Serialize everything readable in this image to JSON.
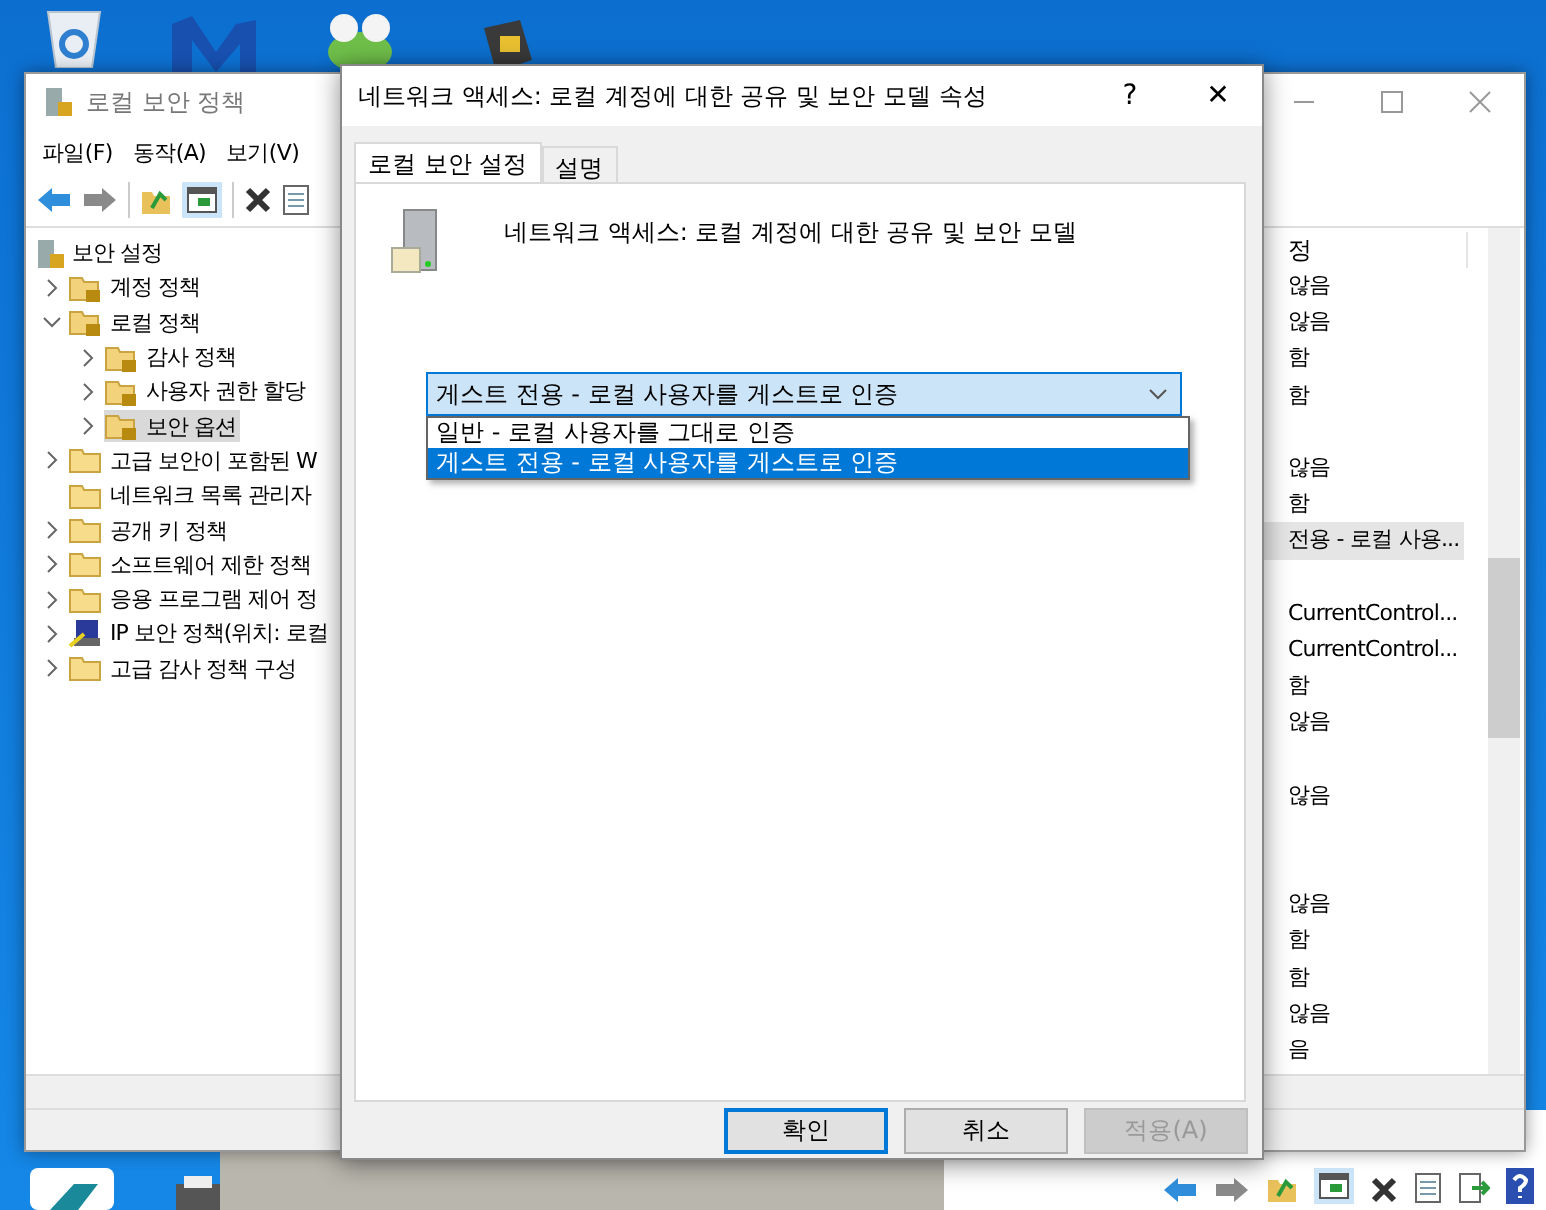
{
  "main_window": {
    "title": "로컬 보안 정책",
    "menu": [
      "파일(F)",
      "동작(A)",
      "보기(V)"
    ],
    "tree": [
      {
        "label": "보안 설정",
        "kind": "root",
        "selected": false,
        "children": [
          {
            "label": "계정 정책",
            "kind": "locked",
            "selected": false,
            "expanded": false
          },
          {
            "label": "로컬 정책",
            "kind": "locked",
            "selected": false,
            "expanded": true,
            "children": [
              {
                "label": "감사 정책",
                "kind": "locked",
                "selected": false,
                "expanded": false
              },
              {
                "label": "사용자 권한 할당",
                "kind": "locked",
                "selected": false,
                "expanded": false
              },
              {
                "label": "보안 옵션",
                "kind": "locked",
                "selected": true,
                "expanded": false
              }
            ]
          },
          {
            "label": "고급 보안이 포함된 W",
            "kind": "plain",
            "selected": false,
            "expanded": false
          },
          {
            "label": "네트워크 목록 관리자",
            "kind": "plain",
            "selected": false
          },
          {
            "label": "공개 키 정책",
            "kind": "plain",
            "selected": false,
            "expanded": false
          },
          {
            "label": "소프트웨어 제한 정책",
            "kind": "plain",
            "selected": false,
            "expanded": false
          },
          {
            "label": "응용 프로그램 제어 정",
            "kind": "plain",
            "selected": false,
            "expanded": false
          },
          {
            "label": "IP 보안 정책(위치: 로컬",
            "kind": "network",
            "selected": false,
            "expanded": false
          },
          {
            "label": "고급 감사 정책 구성",
            "kind": "plain",
            "selected": false,
            "expanded": false
          }
        ]
      }
    ],
    "list": {
      "header": "정",
      "rows": [
        {
          "text": "않음",
          "selected": false
        },
        {
          "text": "않음",
          "selected": false
        },
        {
          "text": "함",
          "selected": false
        },
        {
          "text": "함",
          "selected": false
        },
        {
          "selected": false
        },
        {
          "text": "않음",
          "selected": false
        },
        {
          "text": "함",
          "selected": false
        },
        {
          "text": "전용 - 로컬 사용...",
          "selected": true
        },
        {
          "selected": false
        },
        {
          "text": "CurrentControl...",
          "selected": false
        },
        {
          "text": "CurrentControl...",
          "selected": false
        },
        {
          "text": "함",
          "selected": false
        },
        {
          "text": "않음",
          "selected": false
        },
        {
          "selected": false
        },
        {
          "text": "않음",
          "selected": false
        },
        {
          "selected": false
        },
        {
          "selected": false
        },
        {
          "text": "않음",
          "selected": false
        },
        {
          "text": "함",
          "selected": false
        },
        {
          "text": "함",
          "selected": false
        },
        {
          "text": "않음",
          "selected": false
        },
        {
          "text": "음",
          "selected": false
        }
      ]
    }
  },
  "dialog": {
    "title": "네트워크 액세스: 로컬 계정에 대한 공유 및 보안 모델 속성",
    "help": "?",
    "close": "✕",
    "tabs": [
      {
        "label": "로컬 보안 설정",
        "selected": true
      },
      {
        "label": "설명",
        "selected": false
      }
    ],
    "heading": "네트워크 액세스: 로컬 계정에 대한 공유 및 보안 모델",
    "combo": {
      "value": "게스트 전용 - 로컬 사용자를 게스트로 인증",
      "expanded": true,
      "options": [
        {
          "label": "일반 - 로컬 사용자를 그대로 인증",
          "selected": false
        },
        {
          "label": "게스트 전용 - 로컬 사용자를 게스트로 인증",
          "selected": true
        }
      ]
    },
    "buttons": [
      {
        "label": "확인",
        "kind": "default"
      },
      {
        "label": "취소",
        "kind": "normal"
      },
      {
        "label": "적용(A)",
        "kind": "disabled"
      }
    ]
  }
}
